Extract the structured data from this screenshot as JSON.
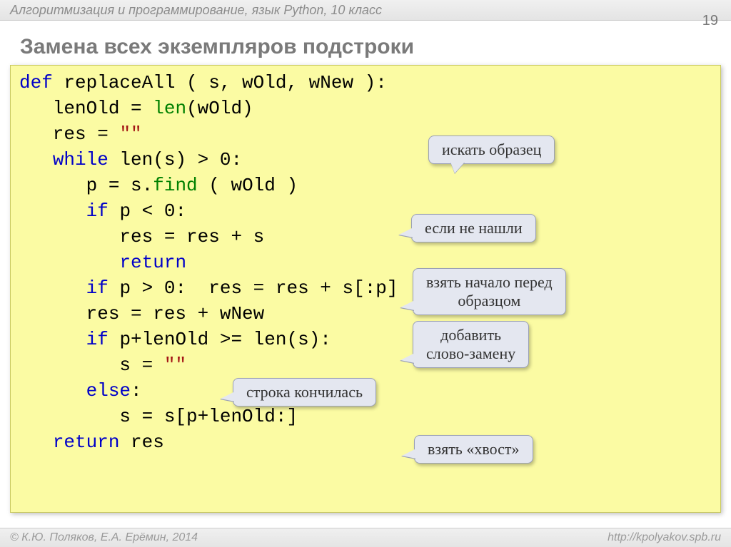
{
  "header": "Алгоритмизация и программирование, язык Python, 10 класс",
  "page_number": "19",
  "title": "Замена всех экземпляров подстроки",
  "code": {
    "l1a": "def",
    "l1b": " replaceAll ( s, wOld, wNew ):",
    "l2a": "   lenOld = ",
    "l2b": "len",
    "l2c": "(wOld)",
    "l3a": "   res = ",
    "l3b": "\"\"",
    "l4a": "   ",
    "l4b": "while",
    "l4c": " len(s) > 0:",
    "l5a": "      p = s.",
    "l5b": "find",
    "l5c": " ( wOld )",
    "l6a": "      ",
    "l6b": "if",
    "l6c": " p < 0:",
    "l7": "         res = res + s",
    "l8a": "         ",
    "l8b": "return",
    "l9a": "      ",
    "l9b": "if",
    "l9c": " p > 0:  res = res + s[:p]",
    "l10": "      res = res + wNew ",
    "l11a": "      ",
    "l11b": "if",
    "l11c": " p+lenOld >= len(s):",
    "l12a": "         s = ",
    "l12b": "\"\"",
    "l13a": "      ",
    "l13b": "else",
    "l13c": ":",
    "l14": "         s = s[p+lenOld:]",
    "l15a": "   ",
    "l15b": "return",
    "l15c": " res"
  },
  "callouts": {
    "c1": "искать образец",
    "c2": "если не нашли",
    "c3": "взять начало перед\nобразцом",
    "c4": "добавить\nслово-замену",
    "c5": "строка кончилась",
    "c6": "взять «хвост»"
  },
  "footer_left": "© К.Ю. Поляков, Е.А. Ерёмин, 2014",
  "footer_right": "http://kpolyakov.spb.ru"
}
